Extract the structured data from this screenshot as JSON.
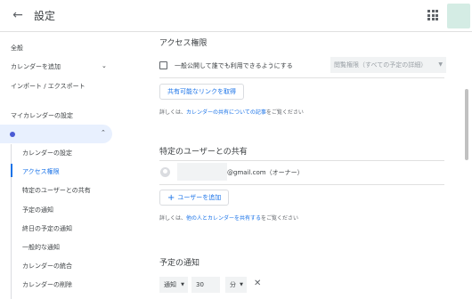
{
  "header": {
    "title": "設定"
  },
  "sidebar": {
    "general": "全般",
    "add_calendar": "カレンダーを追加",
    "import_export": "インポート / エクスポート",
    "my_calendar_settings": "マイカレンダーの設定",
    "sub_items": [
      "カレンダーの設定",
      "アクセス権限",
      "特定のユーザーとの共有",
      "予定の通知",
      "終日の予定の通知",
      "一般的な通知",
      "カレンダーの統合",
      "カレンダーの削除"
    ]
  },
  "access": {
    "title": "アクセス権限",
    "public_label": "一般公開して誰でも利用できるようにする",
    "permission_select": "閲覧権限（すべての予定の詳細）",
    "link_button": "共有可能なリンクを取得",
    "help_prefix": "詳しくは、",
    "help_link": "カレンダーの共有についての記事",
    "help_suffix": "をご覧ください"
  },
  "share": {
    "title": "特定のユーザーとの共有",
    "email": "@gmail.com（オーナー）",
    "add_user": "ユーザーを追加",
    "help_prefix": "詳しくは、",
    "help_link": "他の人とカレンダーを共有する",
    "help_suffix": "をご覧ください"
  },
  "notifications": {
    "title": "予定の通知",
    "type": "通知",
    "value": "30",
    "unit": "分"
  },
  "colors": {
    "accent": "#1a73e8",
    "selected_bg": "#e8f0fe",
    "calendar_dot": "#4a5bd4"
  }
}
